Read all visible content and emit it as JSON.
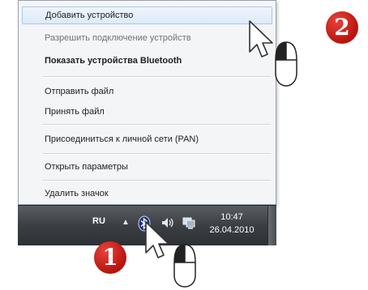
{
  "menu": {
    "items": [
      {
        "label": "Добавить устройство",
        "state": "highlighted"
      },
      {
        "label": "Разрешить подключение устройств",
        "state": "disabled"
      },
      {
        "label": "Показать устройства Bluetooth",
        "state": "bold"
      },
      {
        "label": "Отправить файл",
        "state": "normal"
      },
      {
        "label": "Принять файл",
        "state": "normal"
      },
      {
        "label": "Присоединиться к личной сети (PAN)",
        "state": "normal"
      },
      {
        "label": "Открыть параметры",
        "state": "normal"
      },
      {
        "label": "Удалить значок",
        "state": "normal"
      }
    ]
  },
  "taskbar": {
    "language": "RU",
    "tray_arrow": "▲",
    "clock_time": "10:47",
    "clock_date": "26.04.2010",
    "icons": [
      "bluetooth-icon",
      "volume-icon",
      "network-icon"
    ]
  },
  "steps": {
    "step1": "1",
    "step2": "2"
  },
  "colors": {
    "badge": "#c8201a",
    "menu_highlight": "#dceaf9",
    "taskbar": "#3b3f44"
  }
}
